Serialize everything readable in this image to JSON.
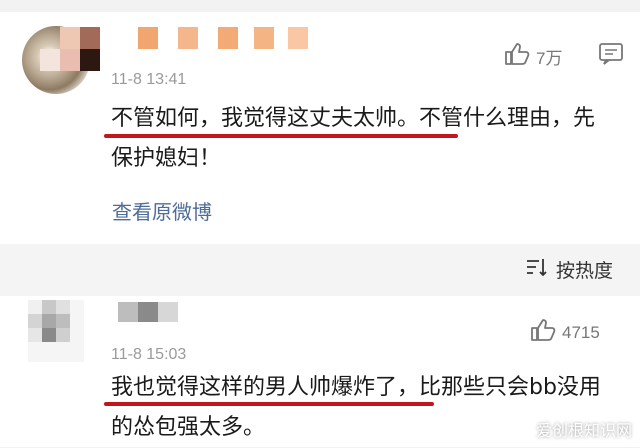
{
  "comment1": {
    "time": "11-8 13:41",
    "likes": "7万",
    "text": "不管如何，我觉得这丈夫太帅。不管什么理由，先保护媳妇！",
    "view_original": "查看原微博"
  },
  "sort": {
    "label": "按热度"
  },
  "comment2": {
    "time": "11-8 15:03",
    "likes": "4715",
    "text": "我也觉得这样的男人帅爆炸了，比那些只会bb没用的怂包强太多。"
  },
  "watermark": "爱创根知识网",
  "colors": {
    "underline": "#c0161c",
    "link": "#4d6c97",
    "mosaic_orange": "#f0a36a"
  },
  "icons": [
    "thumbs-up-icon",
    "comment-icon",
    "sort-icon"
  ]
}
